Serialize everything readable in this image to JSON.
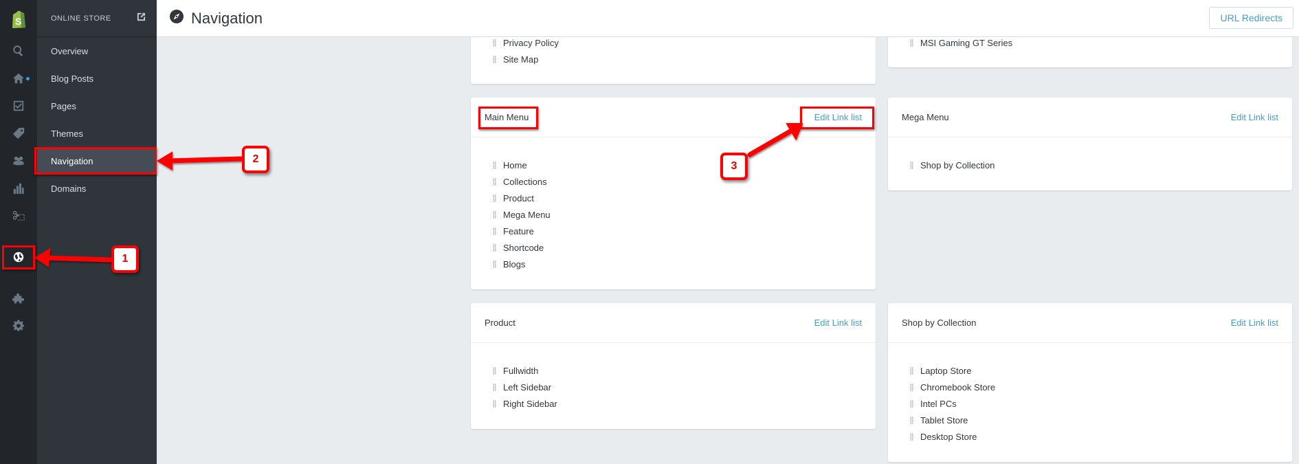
{
  "rail": {
    "icons": [
      {
        "name": "shopify-logo"
      },
      {
        "name": "search-icon"
      },
      {
        "name": "home-icon",
        "notification": true
      },
      {
        "name": "orders-icon"
      },
      {
        "name": "products-tag-icon"
      },
      {
        "name": "customers-icon"
      },
      {
        "name": "reports-icon"
      },
      {
        "name": "discounts-icon"
      },
      {
        "name": "online-store-globe-icon",
        "active": true
      },
      {
        "name": "apps-puzzle-icon"
      },
      {
        "name": "settings-gear-icon"
      }
    ]
  },
  "subnav": {
    "title": "ONLINE STORE",
    "items": [
      {
        "label": "Overview"
      },
      {
        "label": "Blog Posts"
      },
      {
        "label": "Pages"
      },
      {
        "label": "Themes"
      },
      {
        "label": "Navigation",
        "active": true
      },
      {
        "label": "Domains"
      }
    ]
  },
  "header": {
    "title": "Navigation",
    "url_redirects": "URL Redirects"
  },
  "cards": {
    "footer_partial": {
      "items": [
        "Privacy Policy",
        "Site Map"
      ]
    },
    "laptops_partial": {
      "items": [
        "MSI Gaming GT Series"
      ]
    },
    "main_menu": {
      "title": "Main Menu",
      "edit": "Edit Link list",
      "items": [
        "Home",
        "Collections",
        "Product",
        "Mega Menu",
        "Feature",
        "Shortcode",
        "Blogs"
      ]
    },
    "mega_menu": {
      "title": "Mega Menu",
      "edit": "Edit Link list",
      "items": [
        "Shop by Collection"
      ]
    },
    "product": {
      "title": "Product",
      "edit": "Edit Link list",
      "items": [
        "Fullwidth",
        "Left Sidebar",
        "Right Sidebar"
      ]
    },
    "shop_by_collection": {
      "title": "Shop by Collection",
      "edit": "Edit Link list",
      "items": [
        "Laptop Store",
        "Chromebook Store",
        "Intel PCs",
        "Tablet Store",
        "Desktop Store"
      ]
    }
  },
  "annotations": {
    "step1": "1",
    "step2": "2",
    "step3": "3",
    "color": "#ff0000"
  },
  "colors": {
    "link": "#479ccf",
    "rail_bg": "#22262b",
    "subnav_bg": "#30353c",
    "page_bg": "#e9ecef",
    "shopify_green": "#95bf47"
  }
}
